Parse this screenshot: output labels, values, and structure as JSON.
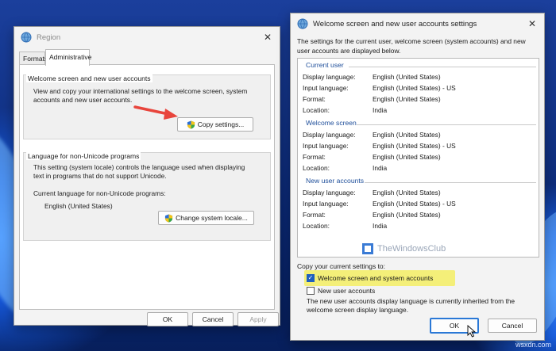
{
  "region_window": {
    "title": "Region",
    "tabs": [
      {
        "label": "Formats",
        "active": false
      },
      {
        "label": "Administrative",
        "active": true
      }
    ],
    "welcome_group": {
      "label": "Welcome screen and new user accounts",
      "description_line1": "View and copy your international settings to the welcome screen, system",
      "description_line2": "accounts and new user accounts.",
      "copy_button": "Copy settings..."
    },
    "unicode_group": {
      "label": "Language for non-Unicode programs",
      "description_line1": "This setting (system locale) controls the language used when displaying",
      "description_line2": "text in programs that do not support Unicode.",
      "current_label": "Current language for non-Unicode programs:",
      "current_value": "English (United States)",
      "change_button": "Change system locale..."
    },
    "buttons": {
      "ok": "OK",
      "cancel": "Cancel",
      "apply": "Apply"
    }
  },
  "welcome_dialog": {
    "title": "Welcome screen and new user accounts settings",
    "intro_line1": "The settings for the current user, welcome screen (system accounts) and new",
    "intro_line2": "user accounts are displayed below.",
    "sections": [
      {
        "heading": "Current user",
        "rows": [
          {
            "label": "Display language:",
            "value": "English (United States)"
          },
          {
            "label": "Input language:",
            "value": "English (United States) - US"
          },
          {
            "label": "Format:",
            "value": "English (United States)"
          },
          {
            "label": "Location:",
            "value": "India"
          }
        ]
      },
      {
        "heading": "Welcome screen",
        "rows": [
          {
            "label": "Display language:",
            "value": "English (United States)"
          },
          {
            "label": "Input language:",
            "value": "English (United States) - US"
          },
          {
            "label": "Format:",
            "value": "English (United States)"
          },
          {
            "label": "Location:",
            "value": "India"
          }
        ]
      },
      {
        "heading": "New user accounts",
        "rows": [
          {
            "label": "Display language:",
            "value": "English (United States)"
          },
          {
            "label": "Input language:",
            "value": "English (United States) - US"
          },
          {
            "label": "Format:",
            "value": "English (United States)"
          },
          {
            "label": "Location:",
            "value": "India"
          }
        ]
      }
    ],
    "brand_text": "TheWindowsClub",
    "copy_label": "Copy your current settings to:",
    "checkboxes": [
      {
        "label": "Welcome screen and system accounts",
        "checked": true
      },
      {
        "label": "New user accounts",
        "checked": false
      }
    ],
    "note_line1": "The new user accounts display language is currently inherited from the",
    "note_line2": "welcome screen display language.",
    "buttons": {
      "ok": "OK",
      "cancel": "Cancel"
    }
  },
  "watermark": "wsxdn.com",
  "colors": {
    "accent": "#2a78d6",
    "highlight": "#f4ef79",
    "arrow": "#e8453c",
    "section_heading": "#1e4e9a"
  }
}
